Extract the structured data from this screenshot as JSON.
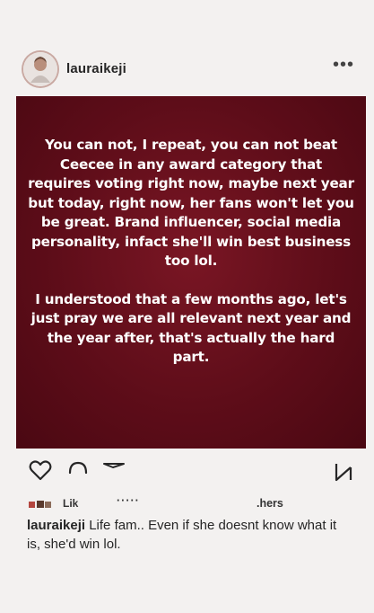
{
  "header": {
    "username": "lauraikeji",
    "more_icon": "more-horizontal-icon"
  },
  "post": {
    "background_color": "#5e0d19",
    "text_color": "#ffffff",
    "paragraphs": [
      "You can not, I repeat,  you can not beat Ceecee in any award category that requires voting right now,  maybe next year but today, right now, her fans won't let you be great. Brand influencer, social media personality, infact she'll win best business too lol.",
      "I understood that a few months ago, let's just pray we are all relevant next year and the year after,  that's  actually the hard part."
    ]
  },
  "actions": {
    "like_icon": "heart-icon",
    "comment_icon": "comment-icon",
    "share_icon": "share-icon",
    "save_icon": "bookmark-icon"
  },
  "likes": {
    "liked_by_prefix": "Lik",
    "liked_by_name": "·····",
    "others_suffix": ".hers"
  },
  "caption": {
    "username": "lauraikeji",
    "text": " Life fam.. Even if she doesnt know what it is, she'd win lol."
  }
}
